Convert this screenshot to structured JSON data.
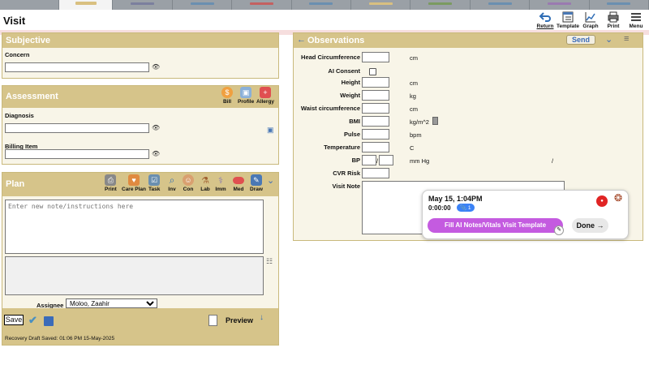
{
  "window": {
    "title": "Visit"
  },
  "tabs": [
    {
      "color": "#9aa0a6",
      "active": false
    },
    {
      "color": "#d9c080",
      "active": true
    },
    {
      "color": "#7b7f9e",
      "active": false
    },
    {
      "color": "#6a8fb0",
      "active": false
    },
    {
      "color": "#c46060",
      "active": false
    },
    {
      "color": "#6a8fb0",
      "active": false
    },
    {
      "color": "#d9c080",
      "active": false
    },
    {
      "color": "#7a9a60",
      "active": false
    },
    {
      "color": "#6a8fb0",
      "active": false
    },
    {
      "color": "#9a7ab0",
      "active": false
    },
    {
      "color": "#6a8fb0",
      "active": false
    }
  ],
  "toolbar": {
    "return_label": "Return",
    "template_label": "Template",
    "graph_label": "Graph",
    "print_label": "Print",
    "menu_label": "Menu"
  },
  "subjective": {
    "title": "Subjective",
    "concern_label": "Concern",
    "concern_value": ""
  },
  "assessment": {
    "title": "Assessment",
    "bill_label": "Bill",
    "profile_label": "Profile",
    "allergy_label": "Allergy",
    "diagnosis_label": "Diagnosis",
    "diagnosis_value": "",
    "billing_label": "Billing Item",
    "billing_value": ""
  },
  "plan": {
    "title": "Plan",
    "buttons": {
      "print": "Print",
      "care_plan": "Care Plan",
      "task": "Task",
      "inv": "Inv",
      "con": "Con",
      "lab": "Lab",
      "imm": "Imm",
      "med": "Med",
      "draw": "Draw"
    },
    "note_placeholder": "Enter new note/instructions here",
    "assignee_label": "Assignee",
    "assignee_value": "Moloo, Zaahir",
    "save_label": "Save",
    "preview_label": "Preview",
    "recovery_text": "Recovery Draft Saved: 01:06 PM 15-May-2025"
  },
  "observations": {
    "title": "Observations",
    "send_label": "Send",
    "rows": [
      {
        "label": "Head Circumference",
        "unit": "cm"
      },
      {
        "label": "AI Consent",
        "unit": ""
      },
      {
        "label": "Height",
        "unit": "cm"
      },
      {
        "label": "Weight",
        "unit": "kg"
      },
      {
        "label": "Waist circumference",
        "unit": "cm"
      },
      {
        "label": "BMI",
        "unit": "kg/m^2"
      },
      {
        "label": "Pulse",
        "unit": "bpm"
      },
      {
        "label": "Temperature",
        "unit": "C"
      },
      {
        "label": "BP",
        "unit": "mm Hg"
      },
      {
        "label": "CVR Risk",
        "unit": ""
      },
      {
        "label": "Visit Note",
        "unit": ""
      }
    ],
    "bp_separator": "/",
    "bp_trailing": "/"
  },
  "ai_popup": {
    "date": "May 15, 1:04PM",
    "timer": "0:00:00",
    "badge": "1",
    "fill_label": "Fill AI Notes/Vitals Visit Template",
    "done_label": "Done →",
    "record_icon": "●"
  },
  "colors": {
    "panel_header": "#d6c48a",
    "panel_bg": "#f8f5e8",
    "ai_button": "#c45be0",
    "record": "#e02424",
    "accent_blue": "#3b6bb8"
  }
}
